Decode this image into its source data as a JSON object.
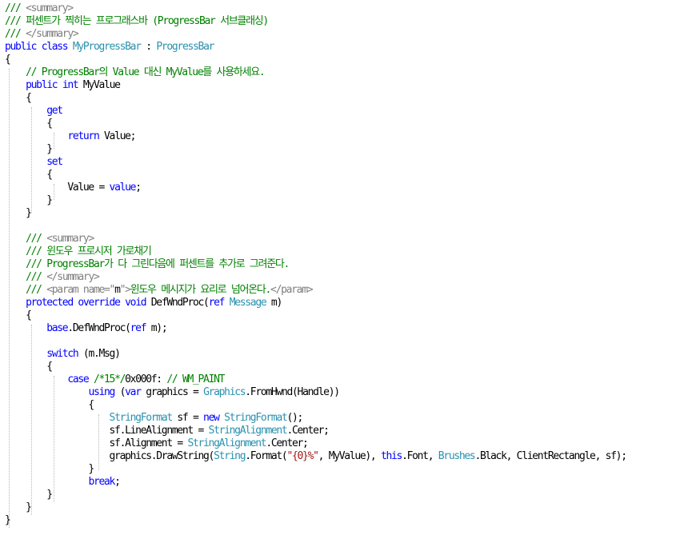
{
  "colors": {
    "background": "#ffffff",
    "keyword": "#0000ff",
    "type": "#2b91af",
    "comment": "#008000",
    "doc_tag": "#808080",
    "string": "#a31515",
    "plain": "#000000"
  },
  "lines": [
    [
      [
        "///",
        "cm"
      ],
      [
        " ",
        "p"
      ],
      [
        "<summary>",
        "dc"
      ]
    ],
    [
      [
        "/// 퍼센트가 찍히는 프로그래스바 (ProgressBar 서브클래싱)",
        "cm"
      ]
    ],
    [
      [
        "///",
        "cm"
      ],
      [
        " ",
        "p"
      ],
      [
        "</summary>",
        "dc"
      ]
    ],
    [
      [
        "public",
        "kw"
      ],
      [
        " ",
        "p"
      ],
      [
        "class",
        "kw"
      ],
      [
        " ",
        "p"
      ],
      [
        "MyProgressBar",
        "ty"
      ],
      [
        " : ",
        "p"
      ],
      [
        "ProgressBar",
        "ty"
      ]
    ],
    [
      [
        "{",
        "p"
      ]
    ],
    [
      [
        "    ",
        "p"
      ],
      [
        "// ProgressBar의 Value 대신 MyValue를 사용하세요.",
        "cm"
      ]
    ],
    [
      [
        "    ",
        "p"
      ],
      [
        "public",
        "kw"
      ],
      [
        " ",
        "p"
      ],
      [
        "int",
        "kw"
      ],
      [
        " MyValue",
        "p"
      ]
    ],
    [
      [
        "    {",
        "p"
      ]
    ],
    [
      [
        "        ",
        "p"
      ],
      [
        "get",
        "kw"
      ]
    ],
    [
      [
        "        {",
        "p"
      ]
    ],
    [
      [
        "            ",
        "p"
      ],
      [
        "return",
        "kw"
      ],
      [
        " Value;",
        "p"
      ]
    ],
    [
      [
        "        }",
        "p"
      ]
    ],
    [
      [
        "        ",
        "p"
      ],
      [
        "set",
        "kw"
      ]
    ],
    [
      [
        "        {",
        "p"
      ]
    ],
    [
      [
        "            Value = ",
        "p"
      ],
      [
        "value",
        "kw"
      ],
      [
        ";",
        "p"
      ]
    ],
    [
      [
        "        }",
        "p"
      ]
    ],
    [
      [
        "    }",
        "p"
      ]
    ],
    [],
    [
      [
        "    ",
        "p"
      ],
      [
        "///",
        "cm"
      ],
      [
        " ",
        "p"
      ],
      [
        "<summary>",
        "dc"
      ]
    ],
    [
      [
        "    ",
        "p"
      ],
      [
        "/// 윈도우 프로시저 가로채기",
        "cm"
      ]
    ],
    [
      [
        "    ",
        "p"
      ],
      [
        "/// ProgressBar가 다 그린다음에 퍼센트를 추가로 그려준다.",
        "cm"
      ]
    ],
    [
      [
        "    ",
        "p"
      ],
      [
        "///",
        "cm"
      ],
      [
        " ",
        "p"
      ],
      [
        "</summary>",
        "dc"
      ]
    ],
    [
      [
        "    ",
        "p"
      ],
      [
        "///",
        "cm"
      ],
      [
        " ",
        "p"
      ],
      [
        "<param name=\"",
        "dc"
      ],
      [
        "m",
        "p"
      ],
      [
        "\">",
        "dc"
      ],
      [
        "윈도우 메시지가 요리로 넘어온다.",
        "cm"
      ],
      [
        "</param>",
        "dc"
      ]
    ],
    [
      [
        "    ",
        "p"
      ],
      [
        "protected",
        "kw"
      ],
      [
        " ",
        "p"
      ],
      [
        "override",
        "kw"
      ],
      [
        " ",
        "p"
      ],
      [
        "void",
        "kw"
      ],
      [
        " DefWndProc(",
        "p"
      ],
      [
        "ref",
        "kw"
      ],
      [
        " ",
        "p"
      ],
      [
        "Message",
        "ty"
      ],
      [
        " m)",
        "p"
      ]
    ],
    [
      [
        "    {",
        "p"
      ]
    ],
    [
      [
        "        ",
        "p"
      ],
      [
        "base",
        "kw"
      ],
      [
        ".DefWndProc(",
        "p"
      ],
      [
        "ref",
        "kw"
      ],
      [
        " m);",
        "p"
      ]
    ],
    [],
    [
      [
        "        ",
        "p"
      ],
      [
        "switch",
        "kw"
      ],
      [
        " (m.Msg)",
        "p"
      ]
    ],
    [
      [
        "        {",
        "p"
      ]
    ],
    [
      [
        "            ",
        "p"
      ],
      [
        "case",
        "kw"
      ],
      [
        " ",
        "p"
      ],
      [
        "/*15*/",
        "cm"
      ],
      [
        "0x000f: ",
        "p"
      ],
      [
        "// WM_PAINT",
        "cm"
      ]
    ],
    [
      [
        "                ",
        "p"
      ],
      [
        "using",
        "kw"
      ],
      [
        " (",
        "p"
      ],
      [
        "var",
        "kw"
      ],
      [
        " graphics = ",
        "p"
      ],
      [
        "Graphics",
        "ty"
      ],
      [
        ".FromHwnd(Handle))",
        "p"
      ]
    ],
    [
      [
        "                {",
        "p"
      ]
    ],
    [
      [
        "                    ",
        "p"
      ],
      [
        "StringFormat",
        "ty"
      ],
      [
        " sf = ",
        "p"
      ],
      [
        "new",
        "kw"
      ],
      [
        " ",
        "p"
      ],
      [
        "StringFormat",
        "ty"
      ],
      [
        "();",
        "p"
      ]
    ],
    [
      [
        "                    sf.LineAlignment = ",
        "p"
      ],
      [
        "StringAlignment",
        "ty"
      ],
      [
        ".Center;",
        "p"
      ]
    ],
    [
      [
        "                    sf.Alignment = ",
        "p"
      ],
      [
        "StringAlignment",
        "ty"
      ],
      [
        ".Center;",
        "p"
      ]
    ],
    [
      [
        "                    graphics.DrawString(",
        "p"
      ],
      [
        "String",
        "ty"
      ],
      [
        ".Format(",
        "p"
      ],
      [
        "\"{0}%\"",
        "st"
      ],
      [
        ", MyValue), ",
        "p"
      ],
      [
        "this",
        "kw"
      ],
      [
        ".Font, ",
        "p"
      ],
      [
        "Brushes",
        "ty"
      ],
      [
        ".Black, ClientRectangle, sf);",
        "p"
      ]
    ],
    [
      [
        "                }",
        "p"
      ]
    ],
    [
      [
        "                ",
        "p"
      ],
      [
        "break",
        "kw"
      ],
      [
        ";",
        "p"
      ]
    ],
    [
      [
        "        }",
        "p"
      ]
    ],
    [
      [
        "    }",
        "p"
      ]
    ],
    [
      [
        "}",
        "p"
      ]
    ]
  ]
}
